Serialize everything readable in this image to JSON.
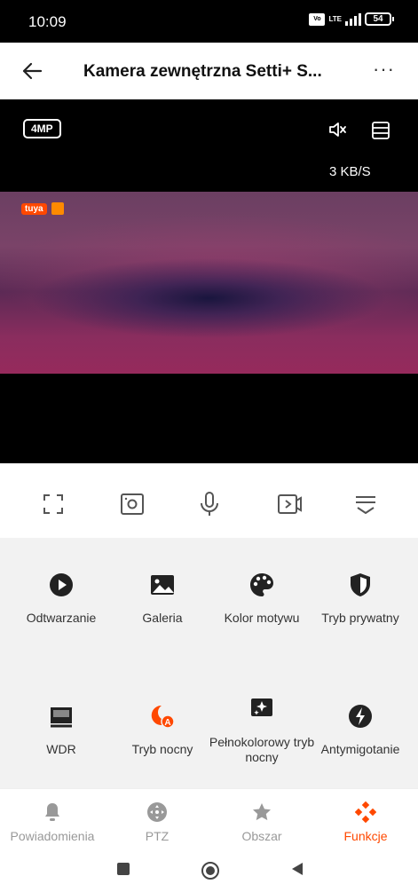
{
  "status_bar": {
    "time": "10:09",
    "network": "LTE",
    "battery": "54"
  },
  "header": {
    "title": "Kamera zewnętrzna Setti+ S...",
    "back_icon": "back-arrow-icon",
    "more_icon": "more-icon"
  },
  "video": {
    "resolution": "4MP",
    "speed": "3 KB/S",
    "overlay_logo": "tuya"
  },
  "controls": [
    "fullscreen-icon",
    "screenshot-icon",
    "microphone-icon",
    "record-icon",
    "collapse-icon"
  ],
  "features": [
    {
      "label": "Odtwarzanie",
      "icon": "play-icon"
    },
    {
      "label": "Galeria",
      "icon": "gallery-icon"
    },
    {
      "label": "Kolor motywu",
      "icon": "palette-icon"
    },
    {
      "label": "Tryb prywatny",
      "icon": "privacy-shield-icon"
    },
    {
      "label": "WDR",
      "icon": "wdr-icon"
    },
    {
      "label": "Tryb nocny",
      "icon": "night-mode-icon"
    },
    {
      "label": "Pełnokolorowy tryb nocny",
      "icon": "full-color-night-icon"
    },
    {
      "label": "Antymigotanie",
      "icon": "anti-flicker-icon"
    }
  ],
  "tabs": [
    {
      "label": "Powiadomienia",
      "icon": "bell-icon"
    },
    {
      "label": "PTZ",
      "icon": "ptz-icon"
    },
    {
      "label": "Obszar",
      "icon": "star-icon"
    },
    {
      "label": "Funkcje",
      "icon": "functions-icon",
      "active": true
    }
  ],
  "colors": {
    "accent": "#ff4800",
    "tab_inactive": "#999999",
    "panel_bg": "#f2f2f2"
  }
}
